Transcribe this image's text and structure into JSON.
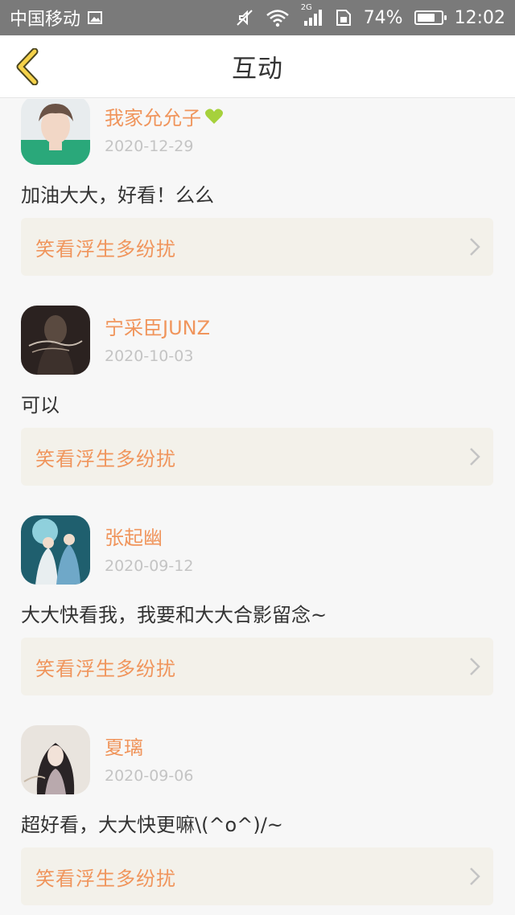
{
  "status_bar": {
    "carrier": "中国移动",
    "network_badge": "2G",
    "battery": "74%",
    "battery_level": 0.74,
    "time": "12:02",
    "icons": [
      "image-icon",
      "mute-icon",
      "wifi-icon",
      "signal-icon",
      "sim-icon",
      "battery-icon"
    ]
  },
  "header": {
    "title": "互动",
    "back_icon": "chevron-left-icon",
    "accent_color": "#f5d24a"
  },
  "colors": {
    "name": "#f0955c",
    "date": "#c4c4c4",
    "card_bg": "#f3f1ea",
    "heart": "#a6d13c"
  },
  "comments": [
    {
      "user": "我家允允子",
      "badge": "heart-icon",
      "date": "2020-12-29",
      "text": "加油大大，好看！么么",
      "book": "笑看浮生多纷扰"
    },
    {
      "user": "宁采臣JUNZ",
      "date": "2020-10-03",
      "text": "可以",
      "book": "笑看浮生多纷扰"
    },
    {
      "user": "张起幽",
      "date": "2020-09-12",
      "text": "大大快看我，我要和大大合影留念~",
      "book": "笑看浮生多纷扰"
    },
    {
      "user": "夏璃",
      "date": "2020-09-06",
      "text": "超好看，大大快更嘛\\(^o^)/~",
      "book": "笑看浮生多纷扰"
    }
  ]
}
